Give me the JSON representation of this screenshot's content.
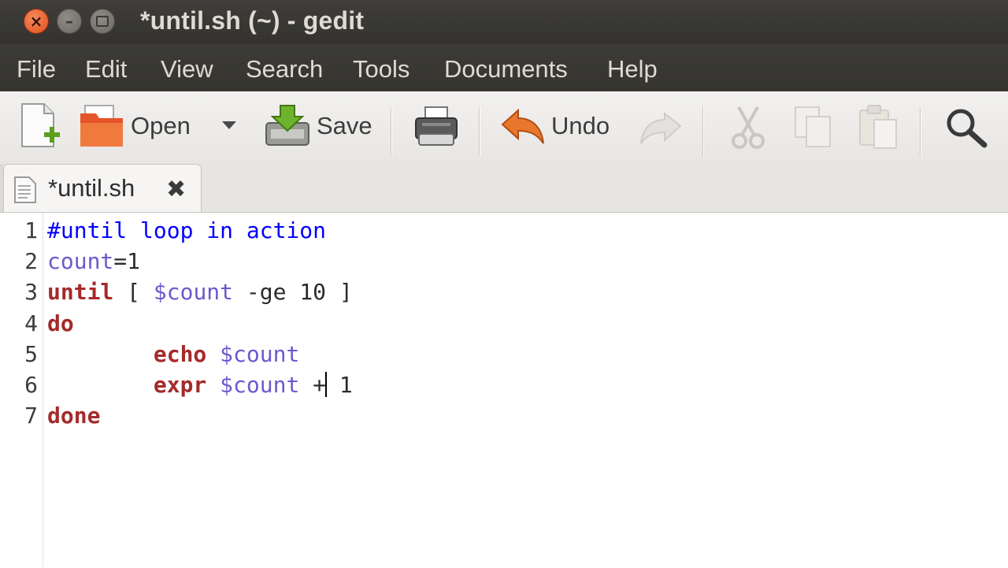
{
  "window": {
    "title": "*until.sh (~) - gedit",
    "buttons": {
      "close": "×",
      "minimize": "–"
    }
  },
  "menu": [
    "File",
    "Edit",
    "View",
    "Search",
    "Tools",
    "Documents",
    "Help"
  ],
  "toolbar": {
    "open_label": "Open",
    "save_label": "Save",
    "undo_label": "Undo",
    "icons": [
      "new-document-icon",
      "open-icon",
      "dropdown-icon",
      "save-icon",
      "print-icon",
      "undo-icon",
      "redo-icon",
      "cut-icon",
      "copy-icon",
      "paste-icon",
      "search-icon"
    ]
  },
  "tab": {
    "label": "*until.sh",
    "close": "✖"
  },
  "editor": {
    "line_numbers": [
      "1",
      "2",
      "3",
      "4",
      "5",
      "6",
      "7"
    ],
    "lines": [
      {
        "parts": [
          {
            "t": "#until loop in action",
            "c": "com"
          }
        ]
      },
      {
        "parts": [
          {
            "t": "count",
            "c": "var"
          },
          {
            "t": "=1",
            "c": "plain"
          }
        ]
      },
      {
        "parts": [
          {
            "t": "until",
            "c": "kw"
          },
          {
            "t": " [ ",
            "c": "plain"
          },
          {
            "t": "$count",
            "c": "var"
          },
          {
            "t": " -ge 10 ]",
            "c": "plain"
          }
        ]
      },
      {
        "parts": [
          {
            "t": "do",
            "c": "kw"
          }
        ]
      },
      {
        "parts": [
          {
            "t": "        ",
            "c": "plain"
          },
          {
            "t": "echo",
            "c": "kw"
          },
          {
            "t": " ",
            "c": "plain"
          },
          {
            "t": "$count",
            "c": "var"
          }
        ]
      },
      {
        "parts": [
          {
            "t": "        ",
            "c": "plain"
          },
          {
            "t": "expr",
            "c": "kw"
          },
          {
            "t": " ",
            "c": "plain"
          },
          {
            "t": "$count",
            "c": "var"
          },
          {
            "t": " +",
            "c": "plain"
          },
          {
            "t": "",
            "c": "caret"
          },
          {
            "t": " 1",
            "c": "plain"
          }
        ]
      },
      {
        "parts": [
          {
            "t": "done",
            "c": "kw"
          }
        ]
      }
    ]
  },
  "colors": {
    "keyword": "#a52a2a",
    "variable": "#6a5acd",
    "comment": "#0000ff",
    "titlebar": "#3c3b37"
  }
}
